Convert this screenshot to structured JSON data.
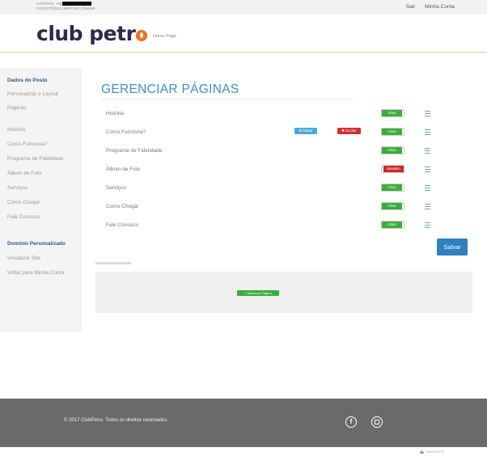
{
  "topbar": {
    "contact_phone_prefix": "CONTATO: +55",
    "contact_phone_suffix": "-",
    "contact_email": "CONTATO@CLUBPETRO.COM.BR",
    "logout_label": "Sair",
    "account_label": "Minha Conta"
  },
  "header": {
    "logo_text": "club petr",
    "nav_home": "Home Page"
  },
  "sidebar": {
    "items": [
      {
        "label": "Dados do Posto",
        "bold": true
      },
      {
        "label": "Personalizar o Layout"
      },
      {
        "label": "Páginas"
      },
      {
        "label": "História"
      },
      {
        "label": "Como Funciona?"
      },
      {
        "label": "Programa de Fidelidade"
      },
      {
        "label": "Álbum de Foto"
      },
      {
        "label": "Serviços"
      },
      {
        "label": "Como Chegar"
      },
      {
        "label": "Fale Conosco"
      },
      {
        "label": "Domínio Personalizado",
        "bold": true
      },
      {
        "label": "Visualizar Site"
      },
      {
        "label": "Voltar para Minha Conta"
      }
    ]
  },
  "main": {
    "title": "GERENCIAR PÁGINAS",
    "edit_label": "Editar",
    "delete_label": "Excluir",
    "pages": [
      {
        "name": "História",
        "status": "Ativo",
        "active": true
      },
      {
        "name": "Como Funciona?",
        "status": "Ativo",
        "active": true
      },
      {
        "name": "Programa de Fidelidade",
        "status": "Ativo",
        "active": true
      },
      {
        "name": "Álbum de Foto",
        "status": "desativo",
        "active": false
      },
      {
        "name": "Serviços",
        "status": "Ativo",
        "active": true
      },
      {
        "name": "Como Chegar",
        "status": "Ativo",
        "active": true
      },
      {
        "name": "Fale Conosco",
        "status": "Ativo",
        "active": true
      }
    ],
    "save_label": "Salvar",
    "add_page_label": "+ Adicionar Página"
  },
  "footer": {
    "copyright": "© 2017 ClubPetro. Todos os direitos reservados.",
    "facebook_icon_glyph": "f",
    "credit": "MINHOSITE"
  },
  "colors": {
    "accent_blue": "#3a90c8",
    "save_blue": "#2f80c0",
    "active_green": "#3cae3c",
    "inactive_red": "#d02828",
    "logo_orange": "#f07020"
  }
}
